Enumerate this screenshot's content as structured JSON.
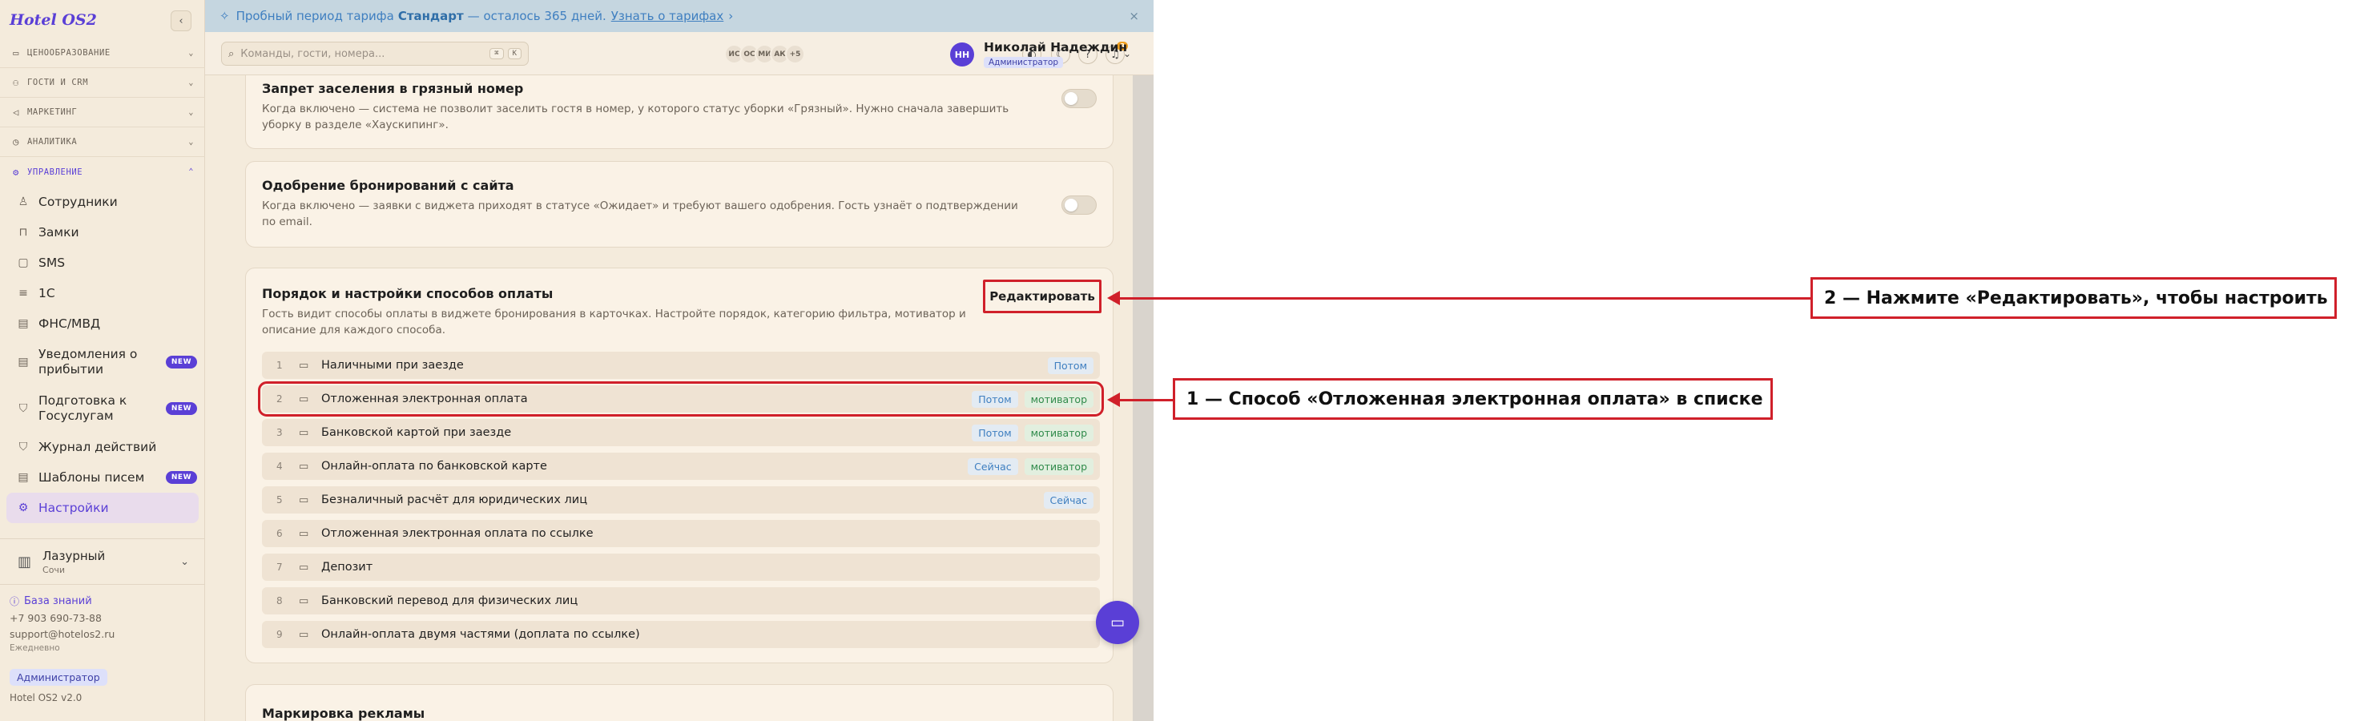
{
  "app": {
    "title": "Hotel OS2",
    "collapse_icon": "chevron-left-icon"
  },
  "sidebar": {
    "groups": [
      {
        "label": "ЦЕНООБРАЗОВАНИЕ",
        "icon": "card-icon"
      },
      {
        "label": "ГОСТИ И CRM",
        "icon": "users-icon"
      },
      {
        "label": "МАРКЕТИНГ",
        "icon": "megaphone-icon"
      },
      {
        "label": "АНАЛИТИКА",
        "icon": "clock-icon"
      },
      {
        "label": "УПРАВЛЕНИЕ",
        "icon": "gear-icon",
        "expanded": true
      }
    ],
    "items": [
      {
        "label": "Сотрудники",
        "icon": "user-icon"
      },
      {
        "label": "Замки",
        "icon": "lock-icon"
      },
      {
        "label": "SMS",
        "icon": "sms-icon"
      },
      {
        "label": "1С",
        "icon": "database-icon"
      },
      {
        "label": "ФНС/МВД",
        "icon": "document-icon"
      },
      {
        "label": "Уведомления о прибытии",
        "icon": "document-icon",
        "badge": "NEW"
      },
      {
        "label": "Подготовка к Госуслугам",
        "icon": "shield-icon",
        "badge": "NEW"
      },
      {
        "label": "Журнал действий",
        "icon": "shield-icon"
      },
      {
        "label": "Шаблоны писем",
        "icon": "document-icon",
        "badge": "NEW"
      },
      {
        "label": "Настройки",
        "icon": "gear-icon",
        "selected": true
      }
    ],
    "hotel": {
      "name": "Лазурный",
      "city": "Сочи"
    },
    "footer": {
      "knowledge_base": "База знаний",
      "phone": "+7 903 690-73-88",
      "email": "support@hotelos2.ru",
      "schedule": "Ежедневно",
      "role": "Администратор",
      "version": "Hotel OS2 v2.0"
    }
  },
  "banner": {
    "prefix": "Пробный период тарифа",
    "plan": "Стандарт",
    "suffix": "— осталось 365 дней.",
    "link": "Узнать о тарифах",
    "arrow": "›",
    "close": "×"
  },
  "topbar": {
    "search_placeholder": "Команды, гости, номера...",
    "kbd1": "⌘",
    "kbd2": "K",
    "avatars": [
      "ИС",
      "ОС",
      "МИ",
      "АК",
      "+5"
    ],
    "notif_count": "3",
    "user_initials": "НН",
    "user_name": "Николай Надеждин",
    "user_role": "Администратор"
  },
  "cards": {
    "dirty_room": {
      "title": "Запрет заселения в грязный номер",
      "desc": "Когда включено — система не позволит заселить гостя в номер, у которого статус уборки «Грязный». Нужно сначала завершить уборку в разделе «Хаускипинг»."
    },
    "booking_approval": {
      "title": "Одобрение бронирований с сайта",
      "desc": "Когда включено — заявки с виджета приходят в статусе «Ожидает» и требуют вашего одобрения. Гость узнаёт о подтверждении по email."
    },
    "payment_methods": {
      "title": "Порядок и настройки способов оплаты",
      "desc": "Гость видит способы оплаты в виджете бронирования в карточках. Настройте порядок, категорию фильтра, мотиватор и описание для каждого способа.",
      "edit_label": "Редактировать",
      "items": [
        {
          "num": "1",
          "name": "Наличными при заезде",
          "tags": [
            {
              "text": "Потом",
              "kind": "blue"
            }
          ]
        },
        {
          "num": "2",
          "name": "Отложенная электронная оплата",
          "tags": [
            {
              "text": "Потом",
              "kind": "blue"
            },
            {
              "text": "мотиватор",
              "kind": "green"
            }
          ]
        },
        {
          "num": "3",
          "name": "Банковской картой при заезде",
          "tags": [
            {
              "text": "Потом",
              "kind": "blue"
            },
            {
              "text": "мотиватор",
              "kind": "green"
            }
          ]
        },
        {
          "num": "4",
          "name": "Онлайн-оплата по банковской карте",
          "tags": [
            {
              "text": "Сейчас",
              "kind": "blue"
            },
            {
              "text": "мотиватор",
              "kind": "green"
            }
          ]
        },
        {
          "num": "5",
          "name": "Безналичный расчёт для юридических лиц",
          "tags": [
            {
              "text": "Сейчас",
              "kind": "blue"
            }
          ]
        },
        {
          "num": "6",
          "name": "Отложенная электронная оплата по ссылке",
          "tags": []
        },
        {
          "num": "7",
          "name": "Депозит",
          "tags": []
        },
        {
          "num": "8",
          "name": "Банковский перевод для физических лиц",
          "tags": []
        },
        {
          "num": "9",
          "name": "Онлайн-оплата двумя частями (доплата по ссылке)",
          "tags": []
        }
      ]
    },
    "ad_marking": {
      "title": "Маркировка рекламы"
    }
  },
  "annotations": {
    "step1": "1 — Способ «Отложенная электронная оплата» в списке",
    "step2": "2 — Нажмите «Редактировать», чтобы настроить"
  },
  "colors": {
    "accent": "#5a3fd6",
    "annotation_red": "#d0202a",
    "background": "#f4ebdc"
  }
}
